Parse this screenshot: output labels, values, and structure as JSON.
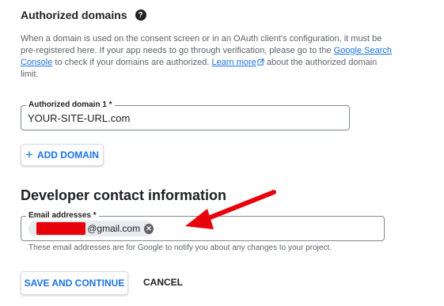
{
  "authorized_domains": {
    "title": "Authorized domains",
    "help_icon": "help-circle-icon",
    "description_part1": "When a domain is used on the consent screen or in an OAuth client's configuration, it must be pre-registered here. If your app needs to go through verification, please go to the ",
    "search_console_link": "Google Search Console",
    "description_part2": " to check if your domains are authorized. ",
    "learn_more_link": "Learn more",
    "description_part3": " about the authorized domain limit.",
    "domain_field": {
      "label": "Authorized domain 1 *",
      "value": "YOUR-SITE-URL.com"
    },
    "add_domain_button": "ADD DOMAIN",
    "add_icon": "plus-icon"
  },
  "developer_contact": {
    "title": "Developer contact information",
    "email_field": {
      "label": "Email addresses *",
      "chip_text": "@gmail.com",
      "chip_close_icon": "cancel-circle-icon"
    },
    "hint": "These email addresses are for Google to notify you about any changes to your project."
  },
  "actions": {
    "save_button": "SAVE AND CONTINUE",
    "cancel_button": "CANCEL"
  },
  "colors": {
    "accent": "#1a73e8",
    "annotation_arrow": "#e8000b",
    "redaction": "#e8000b"
  }
}
